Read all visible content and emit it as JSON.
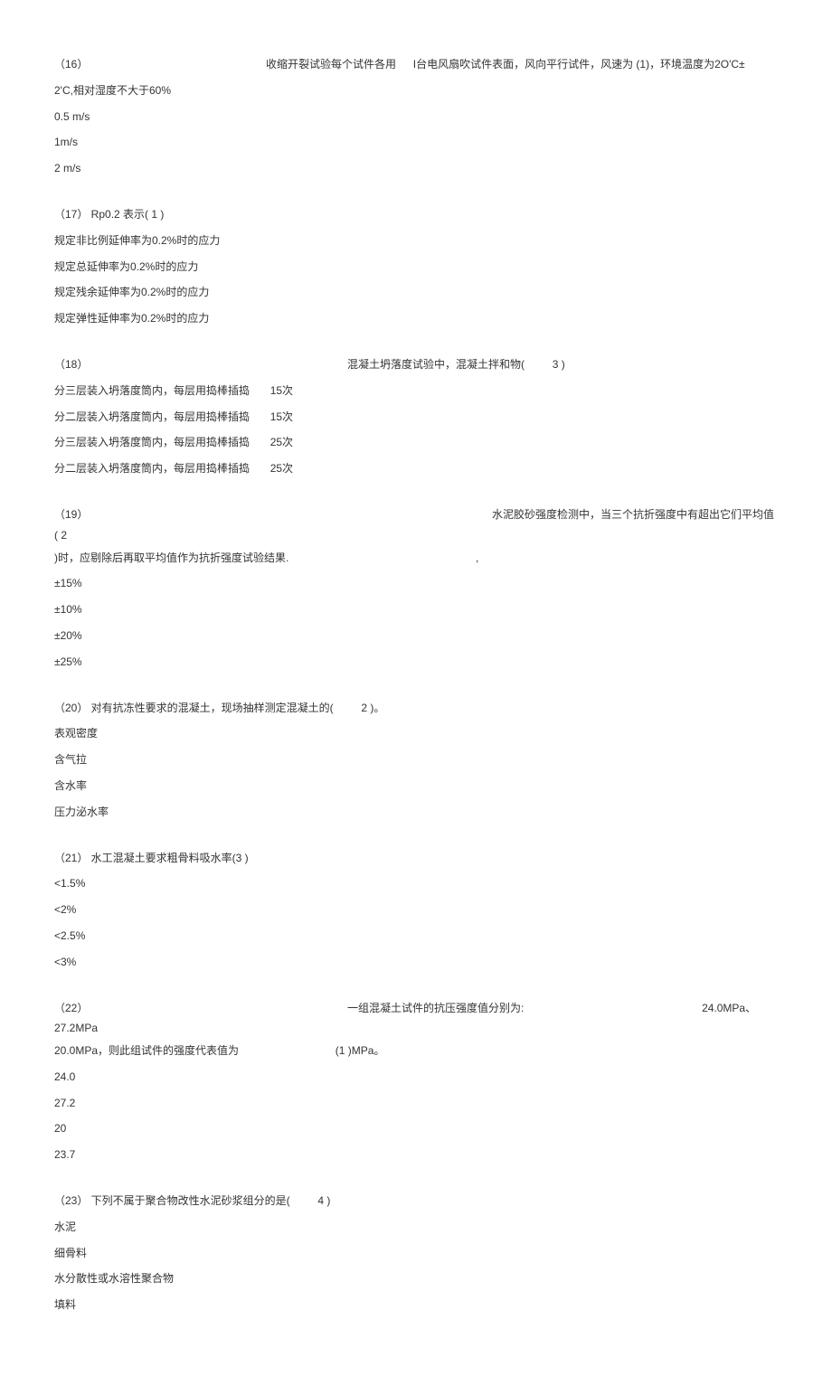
{
  "q16": {
    "stem_part1": "（16）",
    "stem_part2": "收缩开裂试验每个试件各用",
    "stem_part3": "I台电风扇吹试件表面，风向平行试件，风速为 (1)，环境温度为2O'C±",
    "stem_line2": "2'C,相对湿度不大于60%",
    "options": [
      "0.5 m/s",
      "1m/s",
      "2 m/s"
    ]
  },
  "q17": {
    "stem": "（17）  Rp0.2 表示( 1 )",
    "options": [
      "规定非比例延伸率为0.2%时的应力",
      "规定总延伸率为0.2%时的应力",
      "规定残余延伸率为0.2%时的应力",
      "规定弹性延伸率为0.2%时的应力"
    ]
  },
  "q18": {
    "stem_part1": "（18）",
    "stem_part2": "混凝土坍落度试验中，混凝土拌和物(",
    "stem_part3": "3 )",
    "options": [
      {
        "a": "分三层装入坍落度筒内，每层用捣棒插捣",
        "b": "15次"
      },
      {
        "a": "分二层装入坍落度筒内，每层用捣棒插捣",
        "b": "15次"
      },
      {
        "a": "分三层装入坍落度筒内，每层用捣棒插捣",
        "b": "25次"
      },
      {
        "a": "分二层装入坍落度筒内，每层用捣棒插捣",
        "b": "25次"
      }
    ]
  },
  "q19": {
    "stem_part1": "（19）",
    "stem_part2": "水泥胶砂强度检测中，当三个抗折强度中有超出它们平均值(  2",
    "stem_line2a": ")时，应剔除后再取平均值作为抗折强度试验结果.",
    "stem_line2b": ",",
    "options": [
      "±15%",
      "±10%",
      "±20%",
      "±25%"
    ]
  },
  "q20": {
    "stem_part1": "（20）  对有抗冻性要求的混凝土，现场抽样测定混凝土的(",
    "stem_part2": "2 )。",
    "options": [
      "表观密度",
      "含气拉",
      "含水率",
      "压力泌水率"
    ]
  },
  "q21": {
    "stem": "（21）  水工混凝土要求粗骨料吸水率(3 )",
    "options": [
      "<1.5%",
      "<2%",
      "<2.5%",
      "<3%"
    ]
  },
  "q22": {
    "stem_part1": "（22）",
    "stem_part2": "一组混凝土试件的抗压强度值分别为:",
    "stem_part3": "24.0MPa、27.2MPa",
    "stem_line2a": "20.0MPa，则此组试件的强度代表值为",
    "stem_line2b": "(1 )MPa。",
    "options": [
      "24.0",
      "27.2",
      "20",
      "23.7"
    ]
  },
  "q23": {
    "stem_part1": "（23）  下列不属于聚合物改性水泥砂浆组分的是(",
    "stem_part2": "4 )",
    "options": [
      "水泥",
      "细骨料",
      "水分散性或水溶性聚合物",
      "填料"
    ]
  }
}
